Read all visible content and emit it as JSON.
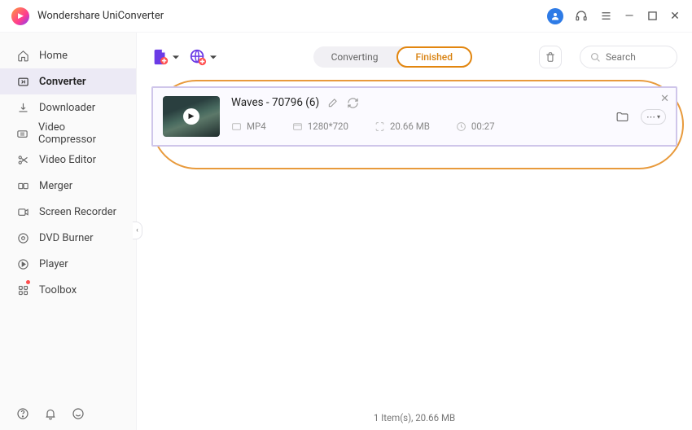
{
  "window": {
    "title": "Wondershare UniConverter"
  },
  "sidebar": {
    "items": [
      {
        "label": "Home"
      },
      {
        "label": "Converter"
      },
      {
        "label": "Downloader"
      },
      {
        "label": "Video Compressor"
      },
      {
        "label": "Video Editor"
      },
      {
        "label": "Merger"
      },
      {
        "label": "Screen Recorder"
      },
      {
        "label": "DVD Burner"
      },
      {
        "label": "Player"
      },
      {
        "label": "Toolbox"
      }
    ]
  },
  "tabs": {
    "converting": "Converting",
    "finished": "Finished"
  },
  "search": {
    "placeholder": "Search"
  },
  "item": {
    "title": "Waves - 70796 (6)",
    "format": "MP4",
    "resolution": "1280*720",
    "size": "20.66 MB",
    "duration": "00:27"
  },
  "footer": {
    "summary": "1 Item(s), 20.66 MB"
  }
}
